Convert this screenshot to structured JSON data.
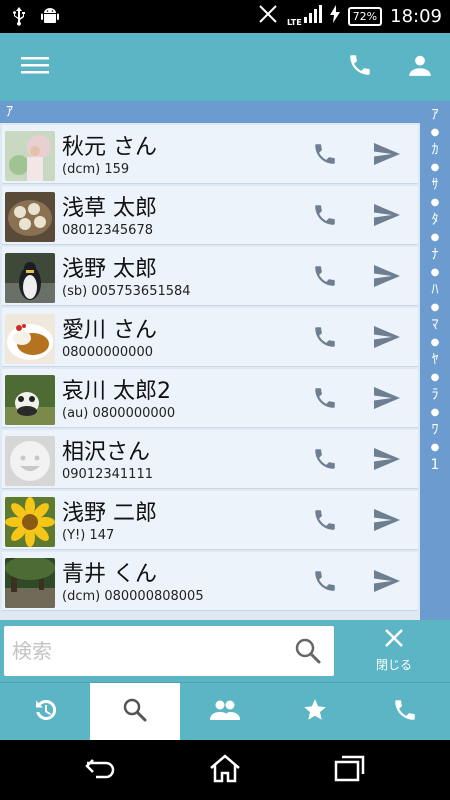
{
  "status_bar": {
    "time": "18:09",
    "battery": "72%",
    "network": "LTE"
  },
  "colors": {
    "accent": "#5cb5c4",
    "index": "#6c9bd0",
    "row": "#edf3fa",
    "icon": "#6d7f90"
  },
  "toolbar": {
    "menu_icon": "menu-icon",
    "call_icon": "phone-icon",
    "profile_icon": "person-icon"
  },
  "section": {
    "header": "ｱ"
  },
  "index": [
    "ｱ",
    "ｶ",
    "ｻ",
    "ﾀ",
    "ﾅ",
    "ﾊ",
    "ﾏ",
    "ﾔ",
    "ﾗ",
    "ﾜ",
    "1"
  ],
  "contacts": [
    {
      "name": "秋元 さん",
      "sub": "(dcm) 159"
    },
    {
      "name": "浅草 太郎",
      "sub": "08012345678"
    },
    {
      "name": "浅野 太郎",
      "sub": "(sb) 005753651584"
    },
    {
      "name": "愛川 さん",
      "sub": "08000000000"
    },
    {
      "name": "哀川 太郎2",
      "sub": "(au) 0800000000"
    },
    {
      "name": "相沢さん",
      "sub": "09012341111"
    },
    {
      "name": "浅野 二郎",
      "sub": "(Y!) 147"
    },
    {
      "name": "青井 くん",
      "sub": "(dcm) 080000808005"
    }
  ],
  "search": {
    "placeholder": "検索",
    "value": "",
    "close_label": "閉じる"
  },
  "tabs": [
    {
      "icon": "history-icon",
      "active": false
    },
    {
      "icon": "search-icon",
      "active": true
    },
    {
      "icon": "group-icon",
      "active": false
    },
    {
      "icon": "star-icon",
      "active": false
    },
    {
      "icon": "phone-icon",
      "active": false
    }
  ]
}
